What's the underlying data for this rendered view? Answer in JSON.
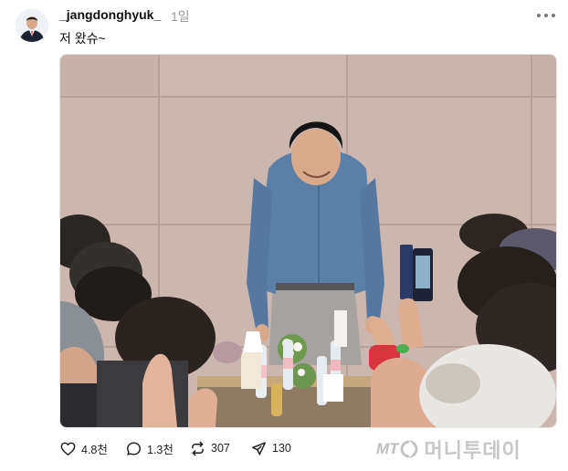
{
  "post": {
    "username": "_jangdonghyuk_",
    "timestamp": "1일",
    "caption": "저 왔슈~"
  },
  "actions": {
    "likes": "4.8천",
    "comments": "1.3천",
    "reposts": "307",
    "shares": "130"
  },
  "watermark": {
    "logo": "MT",
    "text": "머니투데이"
  },
  "icons": {
    "more": "more-horizontal-icon",
    "like": "heart-icon",
    "comment": "comment-bubble-icon",
    "repost": "repost-icon",
    "share": "share-arrow-icon"
  }
}
